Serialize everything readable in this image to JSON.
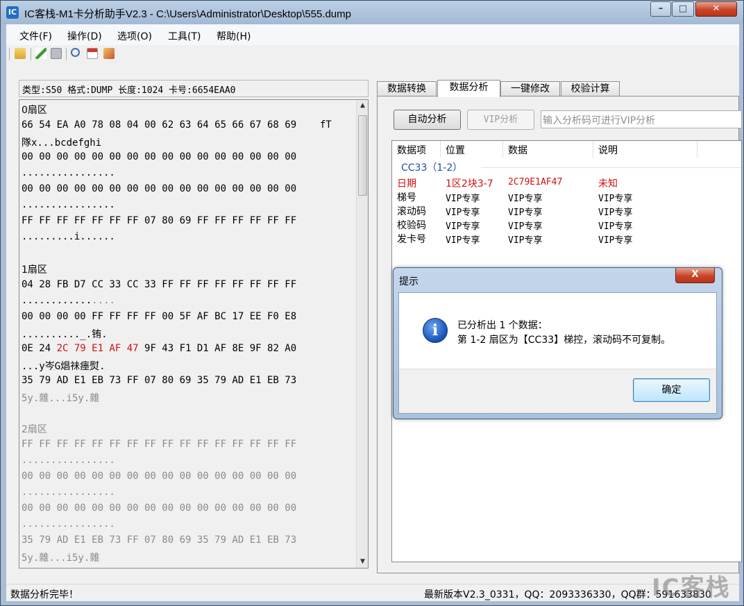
{
  "window": {
    "title": "IC客栈-M1卡分析助手V2.3 - C:\\Users\\Administrator\\Desktop\\555.dump",
    "icon_glyph": "IC"
  },
  "menu": [
    "文件(F)",
    "操作(D)",
    "选项(O)",
    "工具(T)",
    "帮助(H)"
  ],
  "toolbar_icons": [
    "open-folder-icon",
    "edit-icon",
    "save-icon",
    "search-icon",
    "calendar-icon",
    "chart-icon"
  ],
  "info_line": "类型:S50 格式:DUMP 长度:1024 卡号:6654EAA0",
  "hex": {
    "s0_title": "0扇区",
    "s0_l1": "66 54 EA A0 78 08 04 00 62 63 64 65 66 67 68 69    fT",
    "s0_l2": "隊x...bcdefghi",
    "s0_l3": "00 00 00 00 00 00 00 00 00 00 00 00 00 00 00 00",
    "s0_l4": "................",
    "s0_l5": "00 00 00 00 00 00 00 00 00 00 00 00 00 00 00 00",
    "s0_l6": "................",
    "s0_l7": "FF FF FF FF FF FF FF 07 80 69 FF FF FF FF FF FF",
    "s0_l8": ".........i......",
    "s1_title": "1扇区",
    "s1_l1": "04 28 FB D7 CC 33 CC 33 FF FF FF FF FF FF FF FF",
    "s1_l2": "............",
    "s1_l2_dim": "....",
    "s1_l3": "00 00 00 00 FF FF FF FF 00 5F AF BC 17 EE F0 E8",
    "s1_l4": ".........._.铕.",
    "s1_l5_a": "0E 24 ",
    "s1_l5_red": "2C 79 E1 AF 47",
    "s1_l5_b": " 9F 43 F1 D1 AF 8E 9F 82 A0",
    "s1_l6": "...y岑G焻祙瘗熨.",
    "s1_l7": "35 79 AD E1 EB 73 FF 07 80 69 35 79 AD E1 EB 73",
    "s1_l8": "5y.雜...i5y.雜",
    "s2_title": "2扇区",
    "s2_l1": "FF FF FF FF FF FF FF FF FF FF FF FF FF FF FF FF",
    "s2_l2": "................",
    "s2_l3": "00 00 00 00 00 00 00 00 00 00 00 00 00 00 00 00",
    "s2_l4": "................",
    "s2_l5": "00 00 00 00 00 00 00 00 00 00 00 00 00 00 00 00",
    "s2_l6": "................",
    "s2_l7": "35 79 AD E1 EB 73 FF 07 80 69 35 79 AD E1 EB 73",
    "s2_l8": "5y.雜...i5y.雜"
  },
  "tabs": [
    "数据转换",
    "数据分析",
    "一键修改",
    "校验计算"
  ],
  "analysis": {
    "auto_button": "自动分析",
    "vip_button": "VIP分析",
    "vip_placeholder": "输入分析码可进行VIP分析",
    "columns": [
      "数据项",
      "位置",
      "数据",
      "说明"
    ],
    "group": "CC33（1-2）",
    "rows": [
      [
        "日期",
        "1区2块3-7",
        "2C79E1AF47",
        "未知"
      ],
      [
        "梯号",
        "VIP专享",
        "VIP专享",
        "VIP专享"
      ],
      [
        "滚动码",
        "VIP专享",
        "VIP专享",
        "VIP专享"
      ],
      [
        "校验码",
        "VIP专享",
        "VIP专享",
        "VIP专享"
      ],
      [
        "发卡号",
        "VIP专享",
        "VIP专享",
        "VIP专享"
      ]
    ]
  },
  "dialog": {
    "title": "提示",
    "close_glyph": "X",
    "info_glyph": "i",
    "line1": "已分析出 1 个数据：",
    "line2": "第 1-2 扇区为【CC33】梯控，滚动码不可复制。",
    "ok": "确定"
  },
  "status": {
    "left": "数据分析完毕！",
    "right": "最新版本V2.3_0331，QQ：2093336330，QQ群：591633830"
  },
  "watermark": "IC客栈"
}
